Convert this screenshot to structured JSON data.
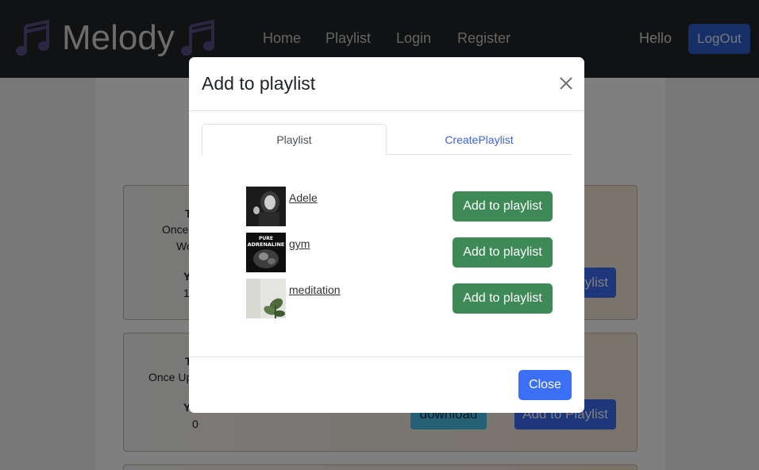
{
  "navbar": {
    "brand": "Melody",
    "links": [
      {
        "label": "Home"
      },
      {
        "label": "Playlist"
      },
      {
        "label": "Login"
      },
      {
        "label": "Register"
      }
    ],
    "greeting": "Hello",
    "logout_label": "LogOut",
    "brand_icon": "music-notes-icon"
  },
  "background_cards": [
    {
      "lines": [
        "T",
        "Once",
        "Wo",
        "Y",
        "1"
      ],
      "buttons": [
        "ylist"
      ]
    },
    {
      "lines": [
        "T",
        "Once Up",
        "Y",
        "0"
      ],
      "buttons": [
        "download",
        "Add to Playlist"
      ]
    }
  ],
  "modal": {
    "title": "Add to playlist",
    "close_icon": "close-icon",
    "tabs": [
      {
        "label": "Playlist",
        "active": true
      },
      {
        "label": "CreatePlaylist",
        "active": false
      }
    ],
    "playlists": [
      {
        "name": "Adele",
        "button": "Add to playlist"
      },
      {
        "name": "gym",
        "button": "Add to playlist",
        "thumb_text": [
          "PURE",
          "ADRENALINE"
        ]
      },
      {
        "name": "meditation",
        "button": "Add to playlist"
      }
    ],
    "close_label": "Close"
  },
  "colors": {
    "navbar_bg": "#212529",
    "primary": "#3b6ff5",
    "success": "#3d8a56",
    "link": "#3d64d4"
  }
}
